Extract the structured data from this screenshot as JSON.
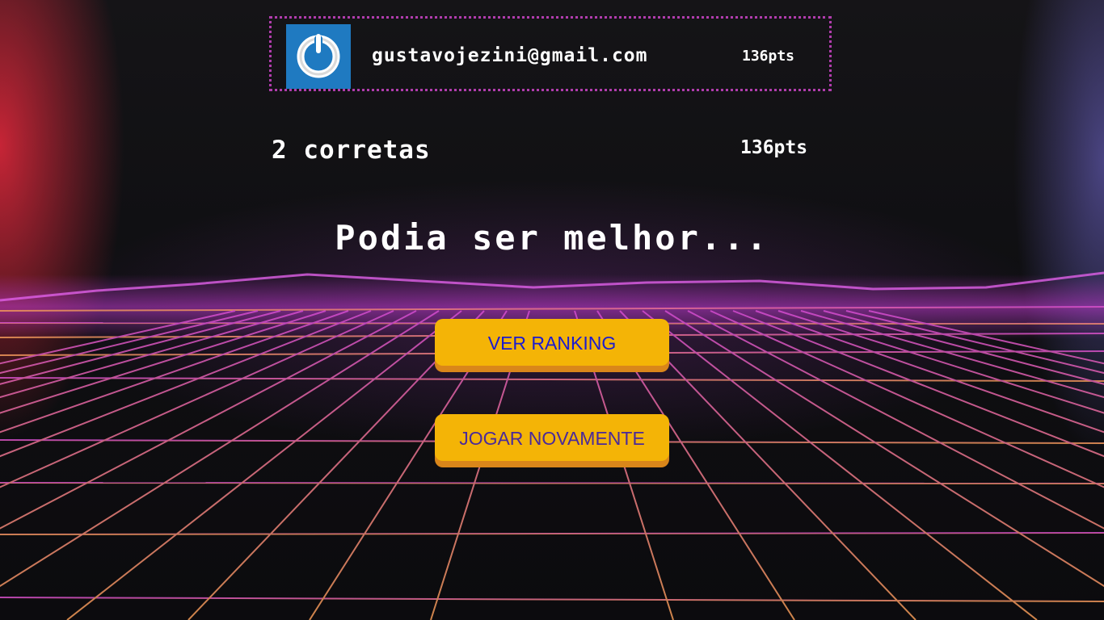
{
  "player": {
    "avatar_icon": "power-icon",
    "email": "gustavojezini@gmail.com",
    "points": "136pts"
  },
  "result": {
    "correct_text": "2 corretas",
    "score_text": "136pts",
    "message": "Podia ser melhor..."
  },
  "actions": {
    "ranking_label": "VER RANKING",
    "replay_label": "JOGAR NOVAMENTE"
  },
  "colors": {
    "card_border": "#b13cad",
    "button_bg": "#f4b406",
    "button_shadow": "#d9861a",
    "ranking_text": "#1b1bd0",
    "replay_text": "#4a2a9a",
    "avatar_bg": "#1f7ac1"
  }
}
